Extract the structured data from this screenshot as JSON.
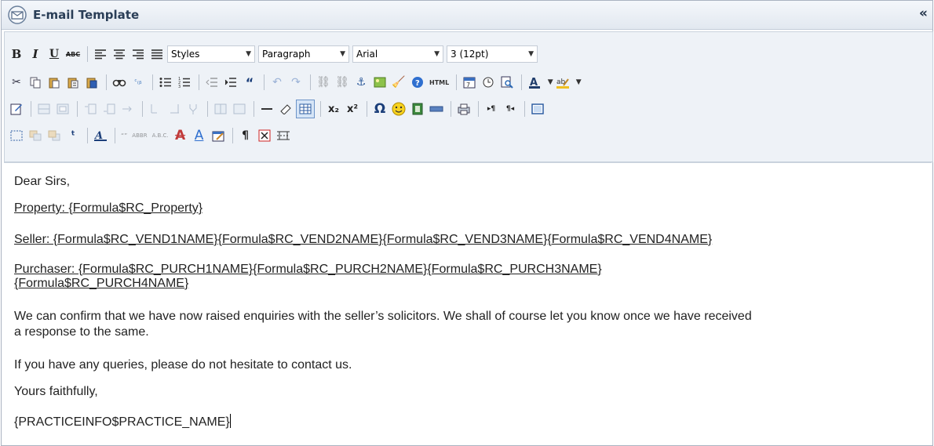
{
  "window": {
    "title": "E-mail Template",
    "collapse_label": "«"
  },
  "toolbar": {
    "styles": {
      "selected": "Styles"
    },
    "format": {
      "selected": "Paragraph"
    },
    "font": {
      "selected": "Arial"
    },
    "size": {
      "selected": "3 (12pt)"
    },
    "html_label": "HTML",
    "sup_label": "x²",
    "sub_label": "x₂"
  },
  "editor": {
    "greeting": "Dear Sirs,",
    "property": "Property: {Formula$RC_Property}",
    "seller": "Seller: {Formula$RC_VEND1NAME}{Formula$RC_VEND2NAME}{Formula$RC_VEND3NAME}{Formula$RC_VEND4NAME}",
    "purchaser_line1": "Purchaser: {Formula$RC_PURCH1NAME}{Formula$RC_PURCH2NAME}{Formula$RC_PURCH3NAME}",
    "purchaser_line2": "{Formula$RC_PURCH4NAME}",
    "body_line1": "We can confirm that we have now raised enquiries with the seller’s solicitors.  We shall of course let you know once we have received",
    "body_line2": "a response to the same.",
    "queries": "If you have any queries, please do not hesitate to contact us.",
    "closing": "Yours faithfully,",
    "signature": "{PRACTICEINFO$PRACTICE_NAME}"
  }
}
